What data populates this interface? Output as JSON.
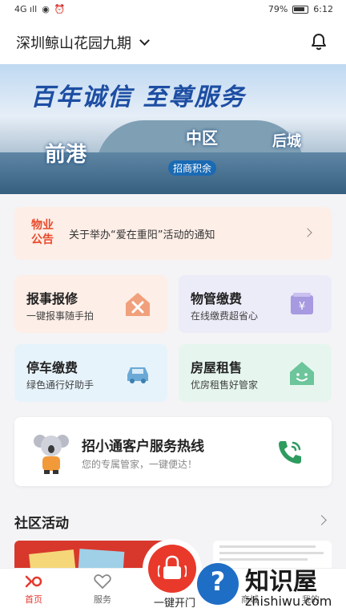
{
  "status_bar": {
    "signal": "4G ıll",
    "battery": "79%",
    "time": "6:12"
  },
  "header": {
    "location": "深圳鲸山花园九期"
  },
  "banner": {
    "slogan": "百年诚信 至尊服务",
    "tag_left": "前港",
    "tag_mid": "中区",
    "tag_right": "后城",
    "brand": "招商积余"
  },
  "notice": {
    "badge_line1": "物业",
    "badge_line2": "公告",
    "text": "关于举办“爱在重阳”活动的通知"
  },
  "services": [
    {
      "title": "报事报修",
      "subtitle": "一键报事随手拍",
      "bg": "#fdeee7",
      "icon_color": "#f1a07c"
    },
    {
      "title": "物管缴费",
      "subtitle": "在线缴费超省心",
      "bg": "#ecebf8",
      "icon_color": "#a79ae0"
    },
    {
      "title": "停车缴费",
      "subtitle": "绿色通行好助手",
      "bg": "#e6f3fb",
      "icon_color": "#6aa9d5"
    },
    {
      "title": "房屋租售",
      "subtitle": "优房租售好管家",
      "bg": "#e6f6ee",
      "icon_color": "#6cc59b"
    }
  ],
  "hotline": {
    "title": "招小通客户服务热线",
    "subtitle": "您的专属管家，一键便达！",
    "phone_color": "#2e9b5f"
  },
  "community": {
    "title": "社区活动"
  },
  "tabbar": {
    "items": [
      {
        "label": "首页"
      },
      {
        "label": "服务"
      },
      {
        "label": "一键开门"
      },
      {
        "label": "商城"
      },
      {
        "label": "我的"
      }
    ],
    "active_color": "#e4392f"
  },
  "watermark": {
    "symbol": "?",
    "name": "知识屋",
    "url": "zhishiwu.com"
  }
}
